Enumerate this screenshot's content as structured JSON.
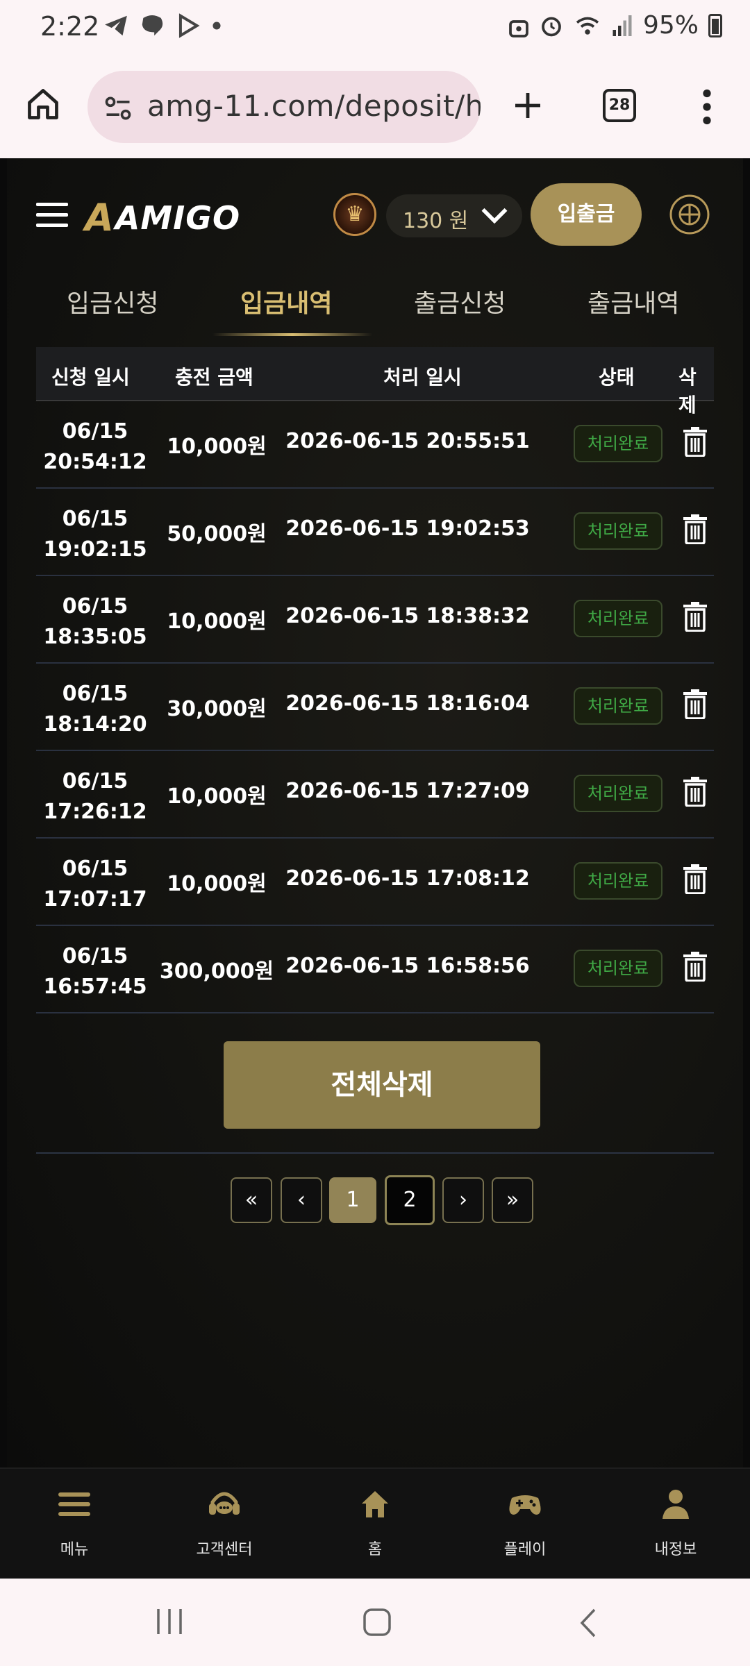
{
  "status_bar": {
    "time": "2:22",
    "battery": "95%"
  },
  "browser": {
    "url": "amg-11.com/deposit/h",
    "tab_count": "28"
  },
  "site": {
    "logo_mark": "A",
    "logo_text": "AMIGO",
    "balance": "130 원",
    "deposit_withdraw_button": "입출금"
  },
  "tabs": [
    {
      "label": "입금신청"
    },
    {
      "label": "입금내역"
    },
    {
      "label": "출금신청"
    },
    {
      "label": "출금내역"
    }
  ],
  "active_tab": "입금내역",
  "table": {
    "headers": {
      "request_time": "신청 일시",
      "amount": "충전 금액",
      "processed_time": "처리 일시",
      "status": "상태",
      "delete": "삭제"
    },
    "rows": [
      {
        "date": "06/15",
        "time": "20:54:12",
        "amount": "10,000원",
        "processed": "2026-06-15 20:55:51",
        "status": "처리완료"
      },
      {
        "date": "06/15",
        "time": "19:02:15",
        "amount": "50,000원",
        "processed": "2026-06-15 19:02:53",
        "status": "처리완료"
      },
      {
        "date": "06/15",
        "time": "18:35:05",
        "amount": "10,000원",
        "processed": "2026-06-15 18:38:32",
        "status": "처리완료"
      },
      {
        "date": "06/15",
        "time": "18:14:20",
        "amount": "30,000원",
        "processed": "2026-06-15 18:16:04",
        "status": "처리완료"
      },
      {
        "date": "06/15",
        "time": "17:26:12",
        "amount": "10,000원",
        "processed": "2026-06-15 17:27:09",
        "status": "처리완료"
      },
      {
        "date": "06/15",
        "time": "17:07:17",
        "amount": "10,000원",
        "processed": "2026-06-15 17:08:12",
        "status": "처리완료"
      },
      {
        "date": "06/15",
        "time": "16:57:45",
        "amount": "300,000원",
        "processed": "2026-06-15 16:58:56",
        "status": "처리완료"
      }
    ]
  },
  "delete_all_button": "전체삭제",
  "pagination": {
    "first": "«",
    "prev": "‹",
    "pages": [
      "1",
      "2"
    ],
    "current_page": "1",
    "next": "›",
    "last": "»"
  },
  "bottom_nav": [
    {
      "label": "메뉴",
      "icon": "menu-icon"
    },
    {
      "label": "고객센터",
      "icon": "support-headset-icon"
    },
    {
      "label": "홈",
      "icon": "home-icon"
    },
    {
      "label": "플레이",
      "icon": "gamepad-icon"
    },
    {
      "label": "내정보",
      "icon": "user-icon"
    }
  ],
  "colors": {
    "accent_gold": "#a89258",
    "status_green": "#3fa845",
    "background": "#131310"
  }
}
